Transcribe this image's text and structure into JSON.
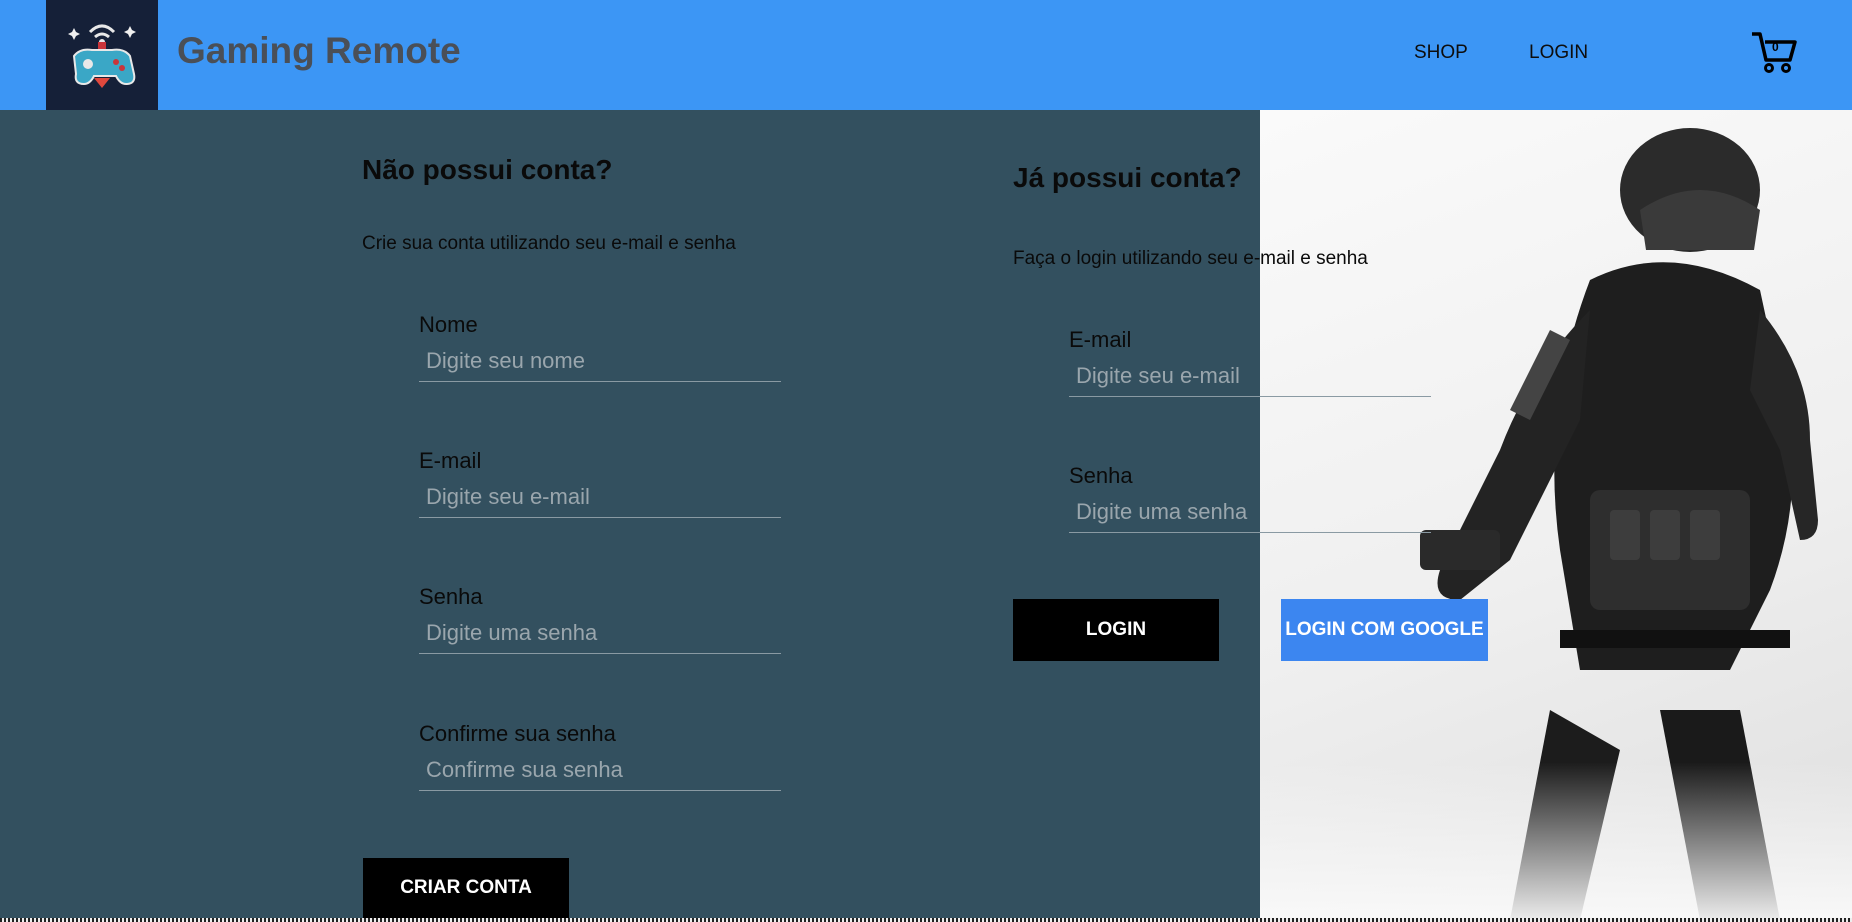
{
  "header": {
    "brand": "Gaming Remote",
    "nav": {
      "shop": "SHOP",
      "login": "LOGIN"
    },
    "cart_count": "0"
  },
  "register": {
    "title": "Não possui conta?",
    "subtitle": "Crie sua conta utilizando seu e-mail e senha",
    "fields": [
      {
        "label": "Nome",
        "placeholder": "Digite seu nome"
      },
      {
        "label": "E-mail",
        "placeholder": "Digite seu e-mail"
      },
      {
        "label": "Senha",
        "placeholder": "Digite uma senha"
      },
      {
        "label": "Confirme sua senha",
        "placeholder": "Confirme sua senha"
      }
    ],
    "submit": "CRIAR CONTA"
  },
  "login": {
    "title": "Já possui conta?",
    "subtitle": "Faça o login utilizando seu e-mail e senha",
    "fields": [
      {
        "label": "E-mail",
        "placeholder": "Digite seu e-mail"
      },
      {
        "label": "Senha",
        "placeholder": "Digite uma senha"
      }
    ],
    "submit": "LOGIN",
    "google": "LOGIN COM GOOGLE"
  },
  "colors": {
    "header": "#3c96f5",
    "background": "#33505f",
    "logo_bg": "#152038",
    "google_button": "#3c86f0"
  },
  "icons": {
    "logo": "gamepad-logo-icon",
    "cart": "shopping-cart-icon"
  }
}
